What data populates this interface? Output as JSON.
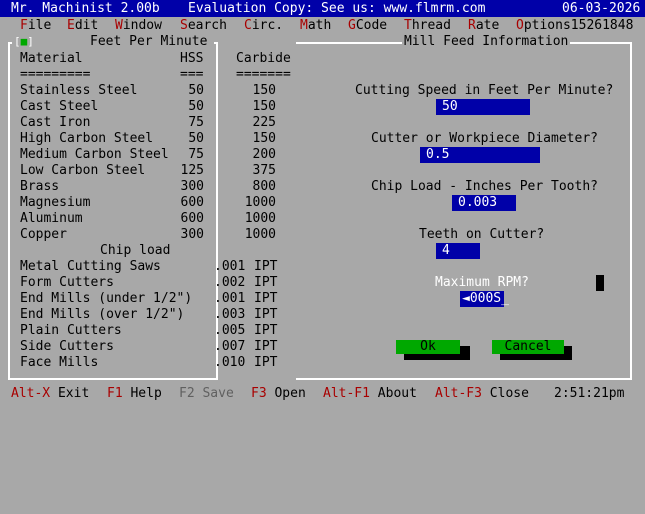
{
  "titlebar": {
    "app": "Mr. Machinist 2.00b",
    "eval": "Evaluation Copy: See us: www.flmrm.com",
    "date": "06-03-2026"
  },
  "menu": [
    {
      "hk": "F",
      "rest": "ile"
    },
    {
      "hk": "E",
      "rest": "dit"
    },
    {
      "hk": "W",
      "rest": "indow"
    },
    {
      "hk": "S",
      "rest": "earch"
    },
    {
      "hk": "C",
      "rest": "irc."
    },
    {
      "hk": "M",
      "rest": "ath"
    },
    {
      "hk": "G",
      "rest": "Code"
    },
    {
      "hk": "T",
      "rest": "hread"
    },
    {
      "hk": "R",
      "rest": "ate"
    },
    {
      "hk": "O",
      "rest": "ptions15261848"
    }
  ],
  "left_window": {
    "title": "Feet Per Minute",
    "headers": {
      "material": "Material",
      "hss": "HSS",
      "carbide": "Carbide"
    },
    "header_rules": {
      "material": "=========",
      "hss": "===",
      "carbide": "======="
    },
    "rows": [
      {
        "name": "Stainless Steel",
        "hss": "50",
        "carbide": "150"
      },
      {
        "name": "Cast Steel",
        "hss": "50",
        "carbide": "150"
      },
      {
        "name": "Cast Iron",
        "hss": "75",
        "carbide": "225"
      },
      {
        "name": "High Carbon Steel",
        "hss": "50",
        "carbide": "150"
      },
      {
        "name": "Medium Carbon Steel",
        "hss": "75",
        "carbide": "200"
      },
      {
        "name": "Low Carbon Steel",
        "hss": "125",
        "carbide": "375"
      },
      {
        "name": "Brass",
        "hss": "300",
        "carbide": "800"
      },
      {
        "name": "Magnesium",
        "hss": "600",
        "carbide": "1000"
      },
      {
        "name": "Aluminum",
        "hss": "600",
        "carbide": "1000"
      },
      {
        "name": "Copper",
        "hss": "300",
        "carbide": "1000"
      }
    ],
    "chip_load_title": "Chip load",
    "chip_rows": [
      {
        "name": "Metal Cutting Saws",
        "value": ".001",
        "unit": "IPT"
      },
      {
        "name": "Form Cutters",
        "value": ".002",
        "unit": "IPT"
      },
      {
        "name": "End Mills (under 1/2\")",
        "value": ".001",
        "unit": "IPT"
      },
      {
        "name": "End Mills (over 1/2\")",
        "value": ".003",
        "unit": "IPT"
      },
      {
        "name": "Plain Cutters",
        "value": ".005",
        "unit": "IPT"
      },
      {
        "name": "Side Cutters",
        "value": ".007",
        "unit": "IPT"
      },
      {
        "name": "Face Mills",
        "value": ".010",
        "unit": "IPT"
      }
    ]
  },
  "right_window": {
    "title": "Mill Feed Information",
    "cutting_speed_label": "Cutting Speed in Feet Per Minute?",
    "cutting_speed_value": "50",
    "diameter_label": "Cutter or Workpiece Diameter?",
    "diameter_value": "0.5",
    "chip_load_label": "Chip Load - Inches Per Tooth?",
    "chip_load_value": "0.003",
    "teeth_label": "Teeth on Cutter?",
    "teeth_value": "4",
    "max_rpm_label": "Maximum RPM?",
    "max_rpm_value": "000S_",
    "ok_label": "Ok",
    "cancel_label": "Cancel"
  },
  "statusbar": {
    "items": [
      {
        "key": "Alt-X",
        "label": " Exit",
        "enabled": true
      },
      {
        "key": "F1",
        "label": " Help",
        "enabled": true
      },
      {
        "key": "F2",
        "label": " Save",
        "enabled": false
      },
      {
        "key": "F3",
        "label": " Open",
        "enabled": true
      },
      {
        "key": "Alt-F1",
        "label": " About",
        "enabled": true
      },
      {
        "key": "Alt-F3",
        "label": " Close",
        "enabled": true
      }
    ],
    "clock": "2:51:21pm"
  },
  "colors": {
    "title_bg": "#0000a8",
    "desktop": "#a8a8a8",
    "hotkey": "#a80000",
    "field_bg": "#0000a8",
    "button": "#00a800"
  }
}
